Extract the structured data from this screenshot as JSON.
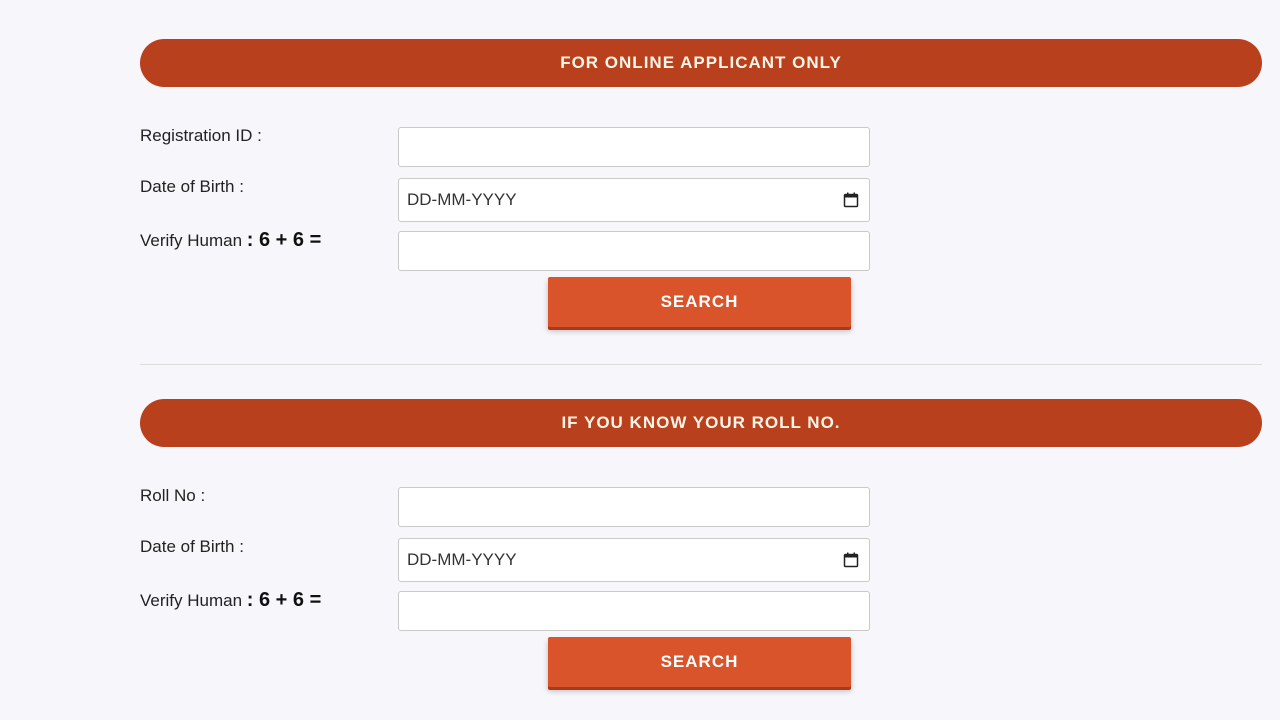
{
  "section1": {
    "header": "FOR ONLINE APPLICANT ONLY",
    "registration_label": "Registration ID :",
    "registration_value": "",
    "dob_label": "Date of Birth :",
    "dob_placeholder": "DD-MM-YYYY",
    "verify_label": "Verify Human",
    "captcha": ": 6 + 6 =",
    "verify_value": "",
    "search_label": "SEARCH"
  },
  "section2": {
    "header": "IF YOU KNOW YOUR ROLL NO.",
    "roll_label": "Roll No :",
    "roll_value": "",
    "dob_label": "Date of Birth :",
    "dob_placeholder": "DD-MM-YYYY",
    "verify_label": "Verify Human",
    "captcha": ": 6 + 6 =",
    "verify_value": "",
    "search_label": "SEARCH"
  },
  "icons": {
    "date_picker": "calendar-icon"
  },
  "colors": {
    "banner": "#b9401d",
    "button": "#d9542a"
  }
}
